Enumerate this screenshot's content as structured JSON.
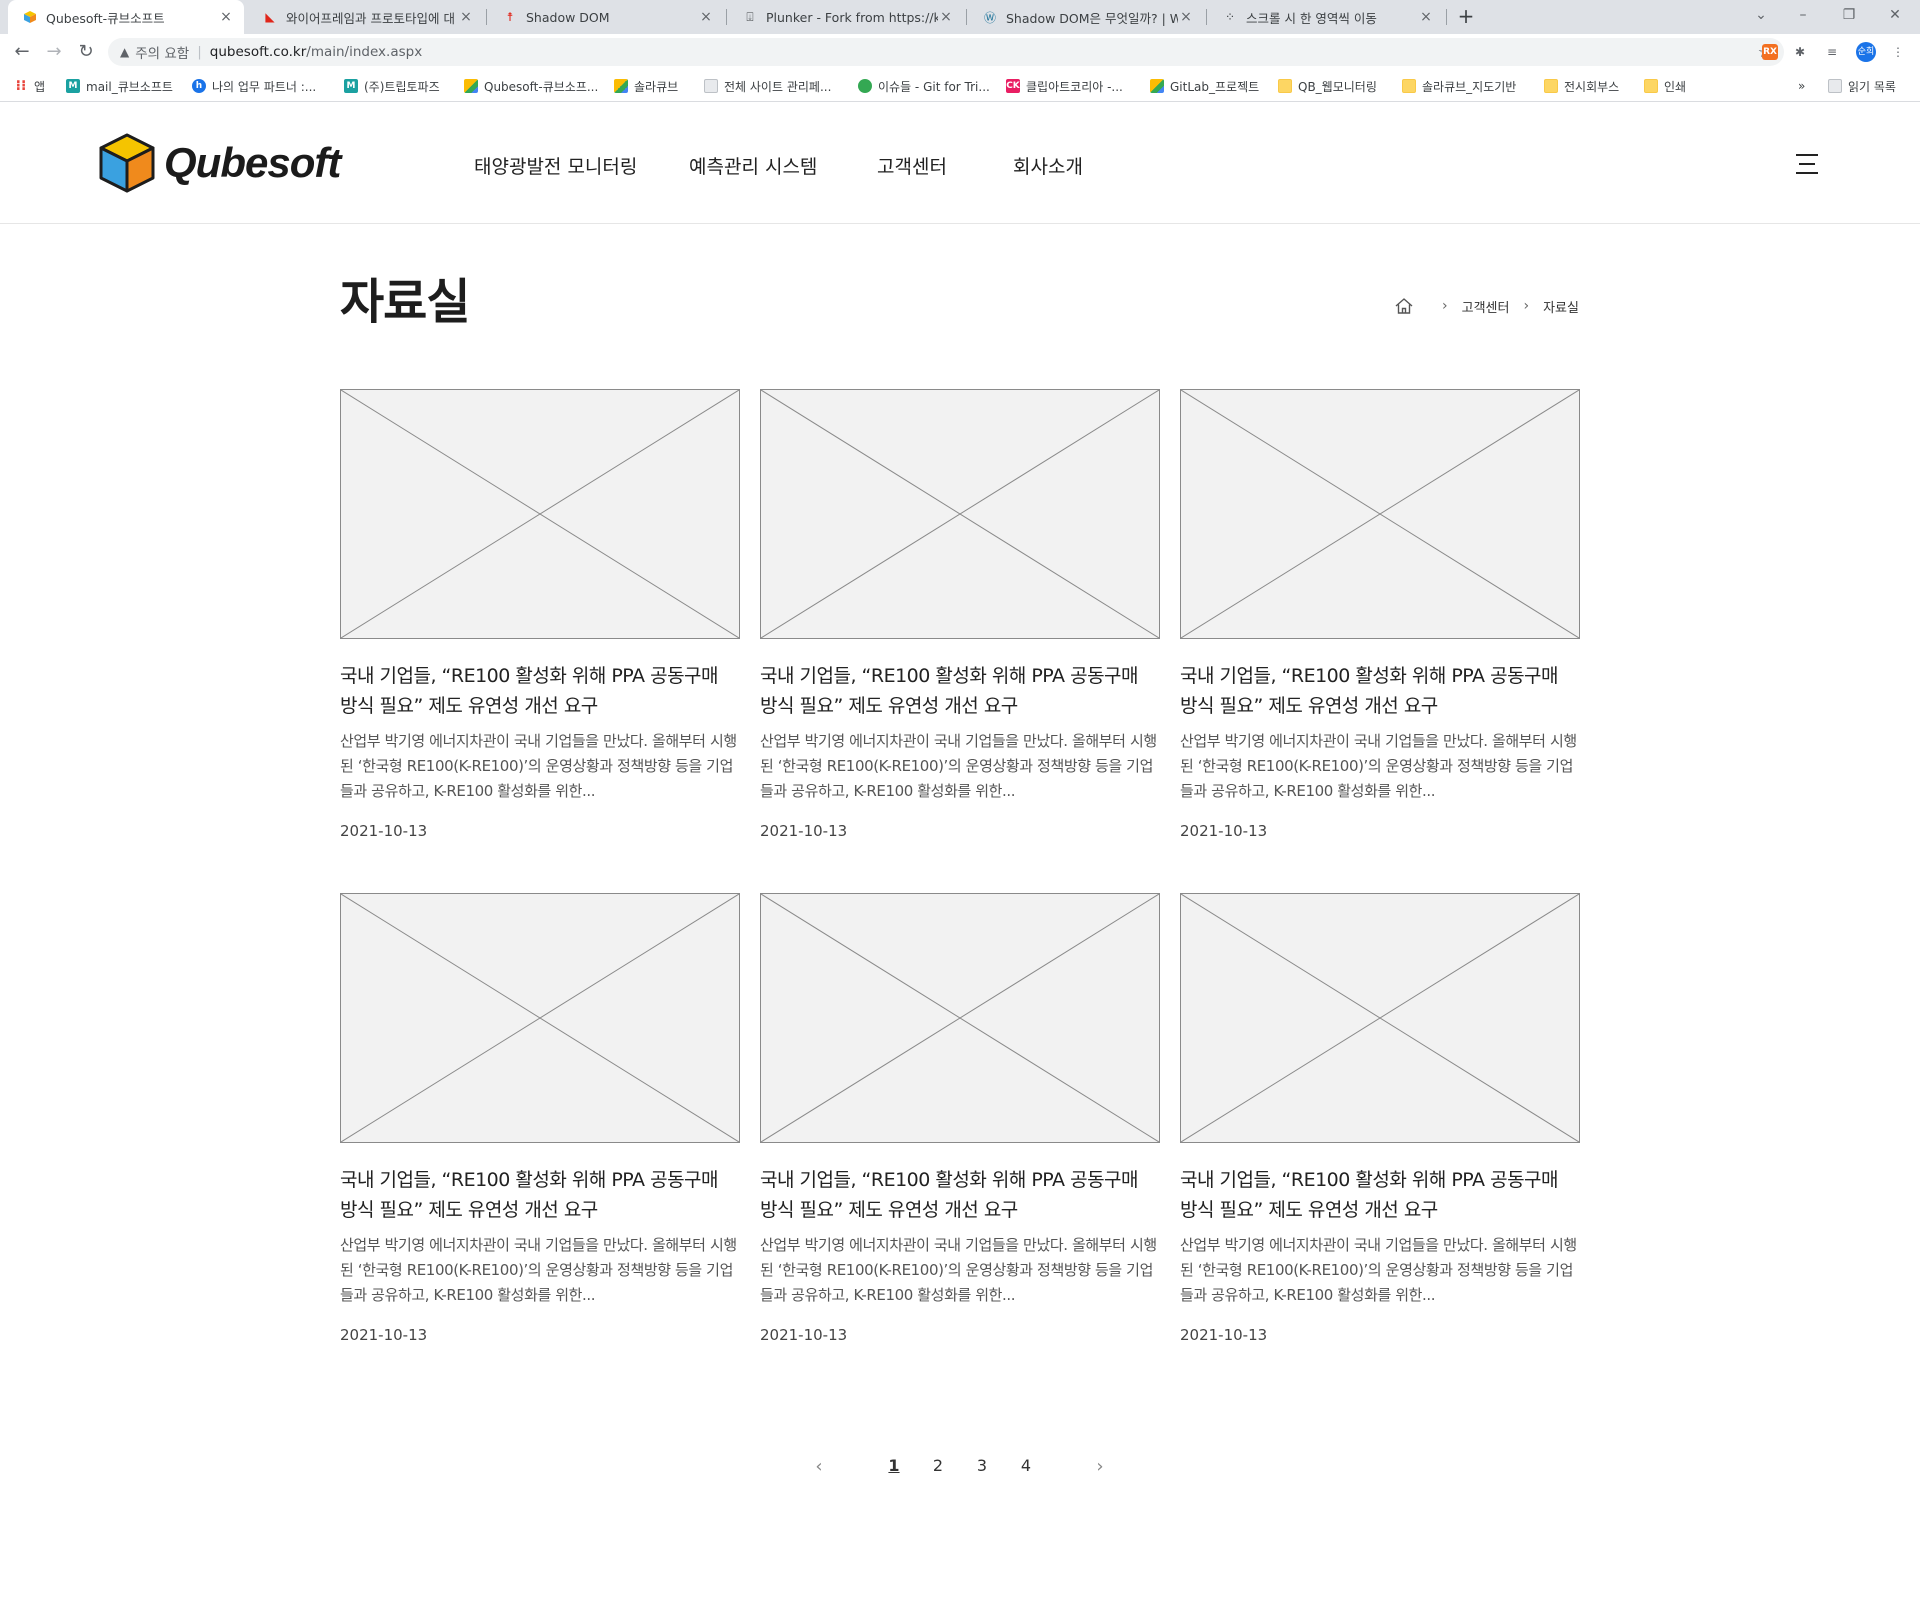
{
  "browser": {
    "tabs": [
      {
        "title": "Qubesoft-큐브소프트",
        "close": "×"
      },
      {
        "title": "와이어프레임과 프로토타입에 대",
        "close": "×"
      },
      {
        "title": "Shadow DOM",
        "close": "×"
      },
      {
        "title": "Plunker - Fork from https://ko.ja",
        "close": "×"
      },
      {
        "title": "Shadow DOM은 무엇일까? | WI",
        "close": "×"
      },
      {
        "title": "스크롤 시 한 영역씩 이동",
        "close": "×"
      }
    ],
    "new_tab": "+",
    "address": {
      "security_label": "주의 요함",
      "host": "qubesoft.co.kr",
      "path": "/main/index.aspx"
    },
    "extensions": {
      "rx": "RX",
      "avatar": "순희"
    },
    "bookmarks": [
      {
        "label": "앱",
        "icon": "apps-icon"
      },
      {
        "label": "mail_큐브소프트",
        "icon": "mail-icon"
      },
      {
        "label": "나의 업무 파트너 :...",
        "icon": "hiworks-icon"
      },
      {
        "label": "(주)트립토파즈",
        "icon": "mail-icon"
      },
      {
        "label": "Qubesoft-큐브소프...",
        "icon": "cube-icon"
      },
      {
        "label": "솔라큐브",
        "icon": "cube-icon"
      },
      {
        "label": "전체 사이트 관리페...",
        "icon": "page-icon"
      },
      {
        "label": "이슈들 - Git for Tri...",
        "icon": "git-icon"
      },
      {
        "label": "클립아트코리아 -...",
        "icon": "ck-icon"
      },
      {
        "label": "GitLab_프로젝트",
        "icon": "cube-icon"
      },
      {
        "label": "QB_웹모니터링",
        "icon": "folder-icon"
      },
      {
        "label": "솔라큐브_지도기반",
        "icon": "folder-icon"
      },
      {
        "label": "전시회부스",
        "icon": "folder-icon"
      },
      {
        "label": "인쇄",
        "icon": "folder-icon"
      }
    ],
    "bookmarks_more": "»",
    "reading_list": "읽기 목록"
  },
  "site": {
    "logo_text": "Qubesoft",
    "nav": [
      "태양광발전 모니터링",
      "예측관리 시스템",
      "고객센터",
      "회사소개"
    ],
    "colors": {
      "cube_top": "#f5c400",
      "cube_left": "#3aa1e0",
      "cube_right": "#f08a1c",
      "cube_edge": "#1d1d1d"
    }
  },
  "page": {
    "title": "자료실",
    "breadcrumb": [
      "고객센터",
      "자료실"
    ]
  },
  "posts": [
    {
      "title": "국내 기업들, “RE100 활성화 위해 PPA 공동구매 방식 필요” 제도 유연성 개선 요구",
      "summary": "산업부 박기영 에너지차관이 국내 기업들을 만났다. 올해부터 시행된 ‘한국형 RE100(K-RE100)’의 운영상황과 정책방향 등을 기업들과 공유하고, K-RE100 활성화를 위한...",
      "date": "2021-10-13"
    },
    {
      "title": "국내 기업들, “RE100 활성화 위해 PPA 공동구매 방식 필요” 제도 유연성 개선 요구",
      "summary": "산업부 박기영 에너지차관이 국내 기업들을 만났다. 올해부터 시행된 ‘한국형 RE100(K-RE100)’의 운영상황과 정책방향 등을 기업들과 공유하고, K-RE100 활성화를 위한...",
      "date": "2021-10-13"
    },
    {
      "title": "국내 기업들, “RE100 활성화 위해 PPA 공동구매 방식 필요” 제도 유연성 개선 요구",
      "summary": "산업부 박기영 에너지차관이 국내 기업들을 만났다. 올해부터 시행된 ‘한국형 RE100(K-RE100)’의 운영상황과 정책방향 등을 기업들과 공유하고, K-RE100 활성화를 위한...",
      "date": "2021-10-13"
    },
    {
      "title": "국내 기업들, “RE100 활성화 위해 PPA 공동구매 방식 필요” 제도 유연성 개선 요구",
      "summary": "산업부 박기영 에너지차관이 국내 기업들을 만났다. 올해부터 시행된 ‘한국형 RE100(K-RE100)’의 운영상황과 정책방향 등을 기업들과 공유하고, K-RE100 활성화를 위한...",
      "date": "2021-10-13"
    },
    {
      "title": "국내 기업들, “RE100 활성화 위해 PPA 공동구매 방식 필요” 제도 유연성 개선 요구",
      "summary": "산업부 박기영 에너지차관이 국내 기업들을 만났다. 올해부터 시행된 ‘한국형 RE100(K-RE100)’의 운영상황과 정책방향 등을 기업들과 공유하고, K-RE100 활성화를 위한...",
      "date": "2021-10-13"
    },
    {
      "title": "국내 기업들, “RE100 활성화 위해 PPA 공동구매 방식 필요” 제도 유연성 개선 요구",
      "summary": "산업부 박기영 에너지차관이 국내 기업들을 만났다. 올해부터 시행된 ‘한국형 RE100(K-RE100)’의 운영상황과 정책방향 등을 기업들과 공유하고, K-RE100 활성화를 위한...",
      "date": "2021-10-13"
    }
  ],
  "pagination": {
    "prev": "‹",
    "pages": [
      "1",
      "2",
      "3",
      "4"
    ],
    "current": "1",
    "next": "›"
  }
}
